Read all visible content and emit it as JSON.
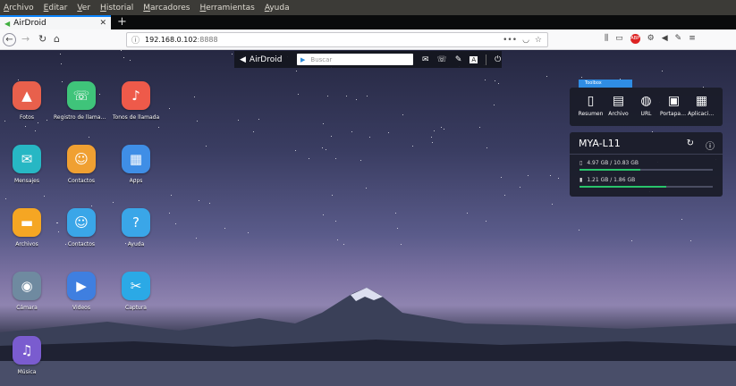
{
  "menu": [
    "Archivo",
    "Editar",
    "Ver",
    "Historial",
    "Marcadores",
    "Herramientas",
    "Ayuda"
  ],
  "tab": {
    "title": "AirDroid",
    "close": "✕",
    "new": "+"
  },
  "url": {
    "host": "192.168.0.102",
    "port": ":8888"
  },
  "airbar": {
    "logo": "AirDroid",
    "search_placeholder": "Buscar"
  },
  "apps": [
    {
      "label": "Fotos",
      "color": "#e8604c",
      "icon": "▲"
    },
    {
      "label": "Registro de llamadas",
      "color": "#3fc47a",
      "icon": "☏"
    },
    {
      "label": "Tonos de llamada",
      "color": "#ee5a4a",
      "icon": "♪"
    },
    {
      "label": "Mensajes",
      "color": "#27b7c4",
      "icon": "✉"
    },
    {
      "label": "Contactos",
      "color": "#f0a032",
      "icon": "☺"
    },
    {
      "label": "Apps",
      "color": "#3f8ee6",
      "icon": "▦"
    },
    {
      "label": "Archivos",
      "color": "#f5a623",
      "icon": "▬"
    },
    {
      "label": "Contactos",
      "color": "#3aa6e8",
      "icon": "☺"
    },
    {
      "label": "Ayuda",
      "color": "#3aa6e8",
      "icon": "?"
    },
    {
      "label": "Cámara",
      "color": "#6f8aa0",
      "icon": "◉"
    },
    {
      "label": "Videos",
      "color": "#3f7fe0",
      "icon": "▶"
    },
    {
      "label": "Captura",
      "color": "#2ba9e6",
      "icon": "✂"
    },
    {
      "label": "Música",
      "color": "#7a5ccf",
      "icon": "♫"
    }
  ],
  "toolbox": {
    "title": "Toolbox",
    "items": [
      {
        "label": "Resumen",
        "icon": "▯"
      },
      {
        "label": "Archivo",
        "icon": "▤"
      },
      {
        "label": "URL",
        "icon": "◍"
      },
      {
        "label": "Portapapeles",
        "icon": "▣"
      },
      {
        "label": "Aplicaciones",
        "icon": "▦"
      }
    ]
  },
  "device": {
    "name": "MYA-L11",
    "storage": [
      {
        "text": "4.97 GB / 10.83 GB",
        "icon": "▯",
        "fraction": 0.459
      },
      {
        "text": "1.21 GB / 1.86 GB",
        "icon": "▮",
        "fraction": 0.651
      }
    ]
  }
}
